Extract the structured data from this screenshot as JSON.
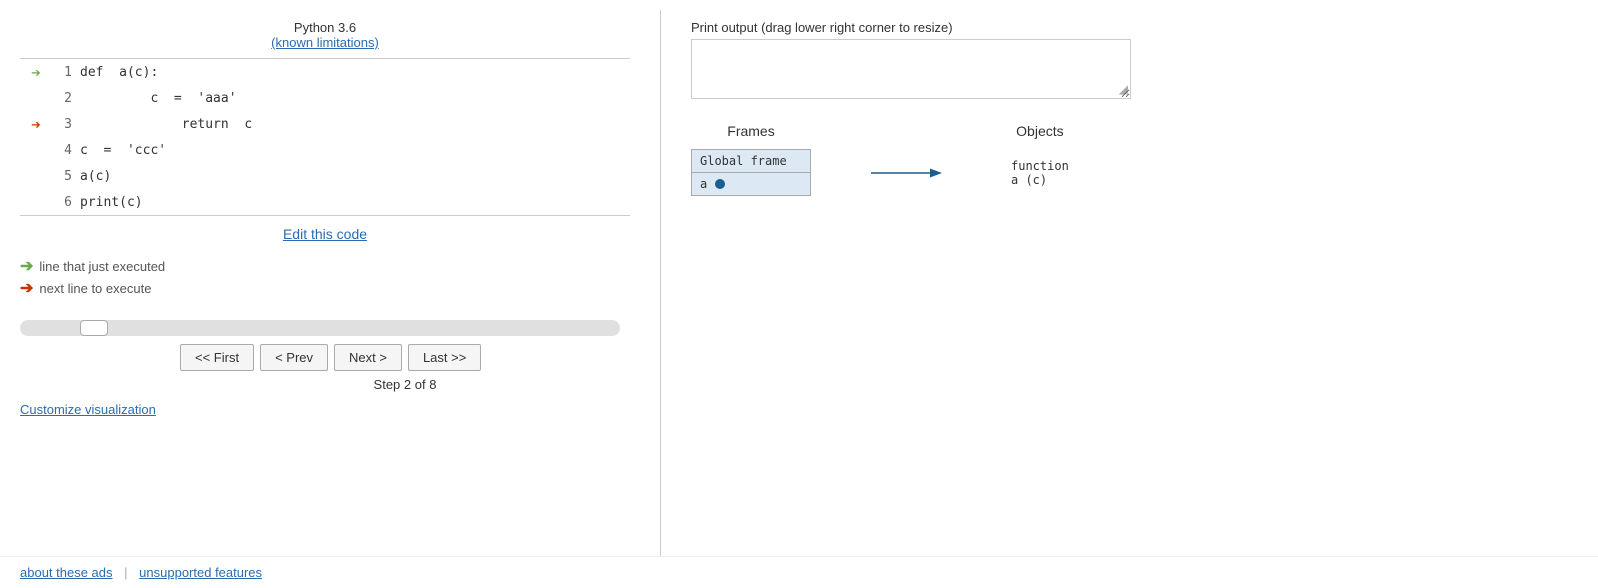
{
  "header": {
    "python_version": "Python 3.6",
    "known_limitations_label": "(known limitations)"
  },
  "code": {
    "lines": [
      {
        "num": 1,
        "content": "def  a(c):",
        "arrow": "green"
      },
      {
        "num": 2,
        "content": "         c  =  'aaa'",
        "arrow": ""
      },
      {
        "num": 3,
        "content": "             return  c",
        "arrow": "red"
      },
      {
        "num": 4,
        "content": "c  =  'ccc'",
        "arrow": ""
      },
      {
        "num": 5,
        "content": "a(c)",
        "arrow": ""
      },
      {
        "num": 6,
        "content": "print(c)",
        "arrow": ""
      }
    ]
  },
  "edit_link": "Edit this code",
  "legend": {
    "green_label": "line that just executed",
    "red_label": "next line to execute"
  },
  "navigation": {
    "first_label": "<< First",
    "prev_label": "< Prev",
    "next_label": "Next >",
    "last_label": "Last >>",
    "step_label": "Step 2 of 8"
  },
  "customize_label": "Customize visualization",
  "print_output": {
    "label": "Print output (drag lower right corner to resize)"
  },
  "frames": {
    "header": "Frames",
    "global_frame": {
      "title": "Global frame",
      "var": "a"
    }
  },
  "objects": {
    "header": "Objects",
    "function_label": "function",
    "function_name": "a (c)"
  },
  "footer": {
    "about_ads": "about these ads",
    "unsupported_features": "unsupported features",
    "separator": "|"
  }
}
